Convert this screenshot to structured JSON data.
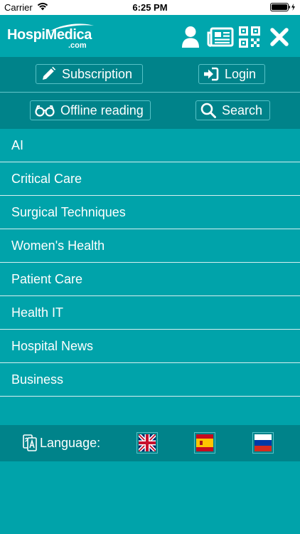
{
  "status_bar": {
    "carrier": "Carrier",
    "time": "6:25 PM"
  },
  "header": {
    "logo_main": "HospiMedica",
    "logo_suffix": ".com",
    "icons": [
      "user-icon",
      "newspaper-icon",
      "qr-code-icon",
      "close-icon"
    ]
  },
  "actions": {
    "subscription": "Subscription",
    "login": "Login",
    "offline_reading": "Offline reading",
    "search": "Search"
  },
  "menu": {
    "items": [
      "AI",
      "Critical Care",
      "Surgical Techniques",
      "Women's Health",
      "Patient Care",
      "Health IT",
      "Hospital News",
      "Business"
    ]
  },
  "language": {
    "label": "Language:",
    "flags": [
      "uk-flag",
      "spain-flag",
      "russia-flag"
    ]
  },
  "colors": {
    "header": "#00a6ad",
    "action_rows": "#00838a",
    "menu_bg": "#00a3aa",
    "divider": "#d7f0f1",
    "button_border": "#56c2c7",
    "text": "#ffffff"
  }
}
